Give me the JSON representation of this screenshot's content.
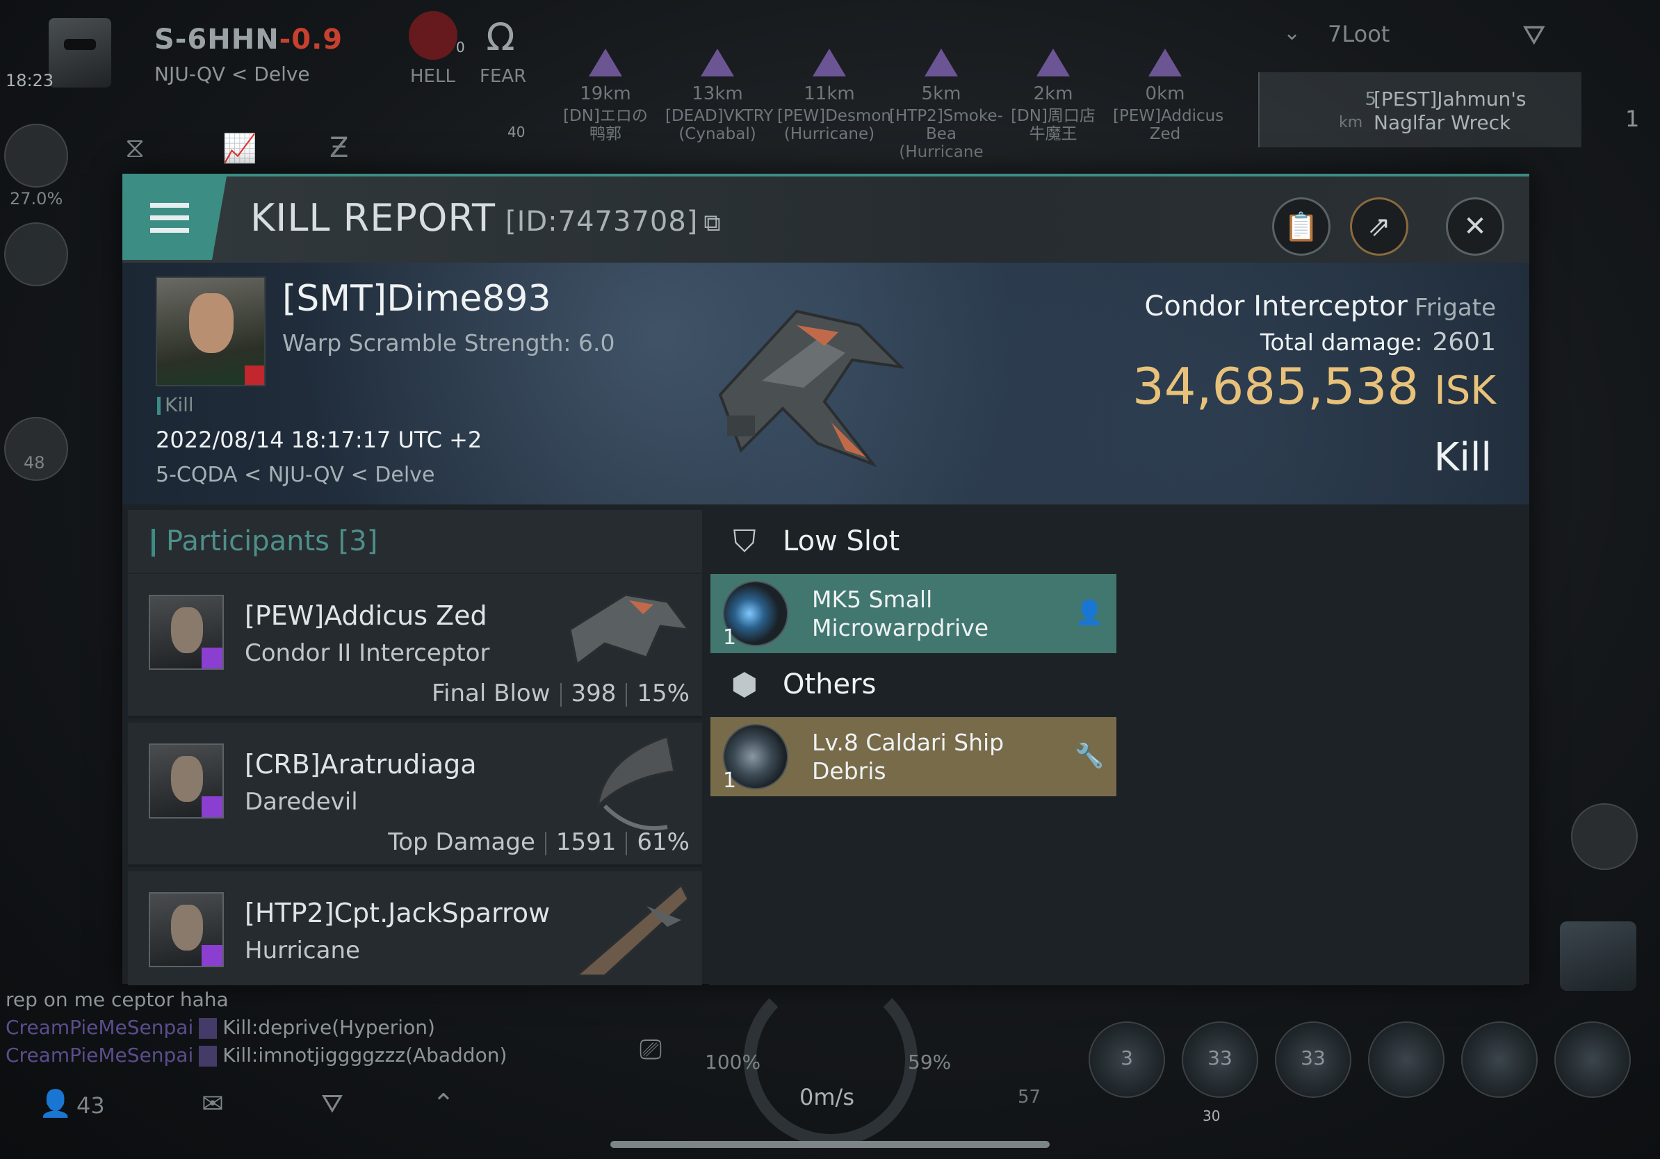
{
  "hud": {
    "clock": "18:23",
    "system_name": "S-6HHN",
    "system_security": "-0.9",
    "system_path": "NJU-QV < Delve",
    "left_percent": "27.0%",
    "left_count": "48",
    "hell_label": "HELL",
    "hell_count": "0",
    "fear_label": "FEAR",
    "bracket_marker": "40",
    "overview": [
      {
        "distance": "19km",
        "name": "[DN]エロの\n鸭郭"
      },
      {
        "distance": "13km",
        "name": "[DEAD]VKTRY\n(Cynabal)"
      },
      {
        "distance": "11km",
        "name": "[PEW]Desmon\n(Hurricane)"
      },
      {
        "distance": "5km",
        "name": "[HTP2]Smoke-Bea\n(Hurricane"
      },
      {
        "distance": "2km",
        "name": "[DN]周口店\n牛魔王"
      },
      {
        "distance": "0km",
        "name": "[PEW]Addicus\nZed"
      }
    ],
    "loot_label": "7Loot",
    "wreck": {
      "distance": "5",
      "unit": "km",
      "name": "[PEST]Jahmun's\nNaglfar Wreck",
      "count": "1"
    }
  },
  "kill_report": {
    "title": "KILL REPORT",
    "id_label": "[ID:7473708]",
    "victim": {
      "name": "[SMT]Dime893",
      "warp_scramble": "Warp Scramble Strength: 6.0",
      "tag": "Kill",
      "datetime": "2022/08/14 18:17:17 UTC +2",
      "location": "5-CQDA < NJU-QV < Delve"
    },
    "ship": {
      "name": "Condor Interceptor",
      "class": "Frigate",
      "total_damage_label": "Total damage:",
      "total_damage": "2601",
      "isk_value": "34,685,538",
      "isk_unit": "ISK",
      "result": "Kill"
    },
    "participants_label": "Participants [3]",
    "participants": [
      {
        "name": "[PEW]Addicus Zed",
        "ship": "Condor II Interceptor",
        "role": "Final Blow",
        "damage": "398",
        "percent": "15%"
      },
      {
        "name": "[CRB]Aratrudiaga",
        "ship": "Daredevil",
        "role": "Top Damage",
        "damage": "1591",
        "percent": "61%"
      },
      {
        "name": "[HTP2]Cpt.JackSparrow",
        "ship": "Hurricane",
        "role": "",
        "damage": "",
        "percent": ""
      }
    ],
    "sections": {
      "low_slot": {
        "title": "Low Slot",
        "item": {
          "qty": "1",
          "name": "MK5 Small\nMicrowarpdrive"
        }
      },
      "others": {
        "title": "Others",
        "item": {
          "qty": "1",
          "name": "Lv.8 Caldari Ship\nDebris"
        }
      }
    }
  },
  "chat": [
    {
      "who": "",
      "text": "rep on me ceptor haha"
    },
    {
      "who": "CreamPieMeSenpai",
      "text": "Kill:deprive(Hyperion)"
    },
    {
      "who": "CreamPieMeSenpai",
      "text": "Kill:imnotjiggggzzz(Abaddon)"
    }
  ],
  "bottom": {
    "members": "43",
    "speed": "0m/s",
    "capacitor": "100%",
    "shield": "59%",
    "num_57": "57",
    "num_30": "30",
    "module_counts": [
      "3",
      "33",
      "33"
    ]
  },
  "colors": {
    "accent_teal": "#3c8d84",
    "isk_gold": "#e8c27a",
    "low_slot_bg": "#427770",
    "others_bg": "#786b4a",
    "security_red": "#c8412e"
  }
}
